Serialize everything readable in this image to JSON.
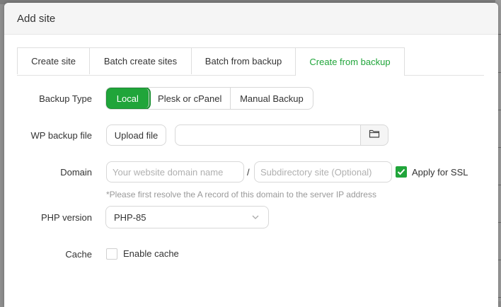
{
  "modal": {
    "title": "Add site"
  },
  "tabs": [
    {
      "label": "Create site",
      "active": false
    },
    {
      "label": "Batch create sites",
      "active": false
    },
    {
      "label": "Batch from backup",
      "active": false
    },
    {
      "label": "Create from backup",
      "active": true
    }
  ],
  "form": {
    "backup_type": {
      "label": "Backup Type",
      "options": [
        "Local",
        "Plesk or cPanel",
        "Manual Backup"
      ],
      "selected": "Local"
    },
    "wp_backup_file": {
      "label": "WP backup file",
      "upload_label": "Upload file",
      "value": "",
      "browse_icon": "folder-icon"
    },
    "domain": {
      "label": "Domain",
      "domain_placeholder": "Your website domain name",
      "separator": "/",
      "subdir_placeholder": "Subdirectory site (Optional)",
      "ssl_label": "Apply for SSL",
      "ssl_checked": true,
      "hint": "*Please first resolve the A record of this domain to the server IP address"
    },
    "php_version": {
      "label": "PHP version",
      "selected": "PHP-85",
      "icon": "chevron-down-icon"
    },
    "cache": {
      "label": "Cache",
      "option_label": "Enable cache",
      "checked": false
    }
  },
  "colors": {
    "accent": "#20a53a",
    "header_bg": "#f5f5f5",
    "border": "#d8d8d8"
  }
}
